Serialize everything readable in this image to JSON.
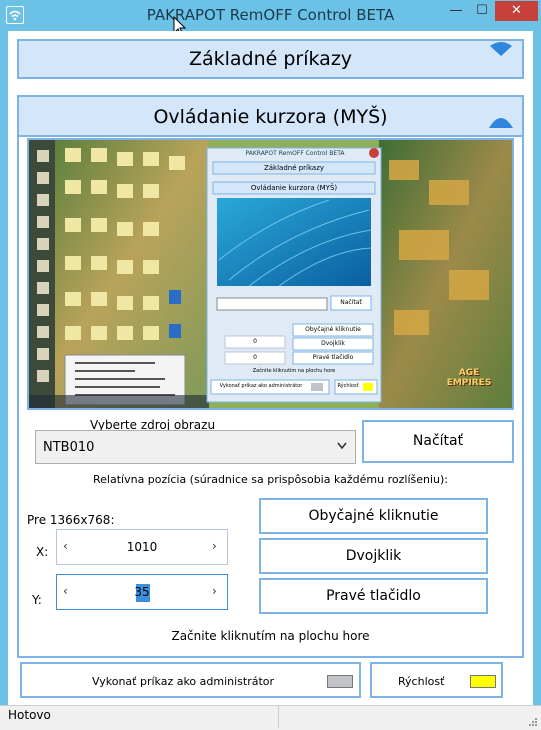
{
  "window": {
    "title": "PAKRAPOT RemOFF Control BETA",
    "minimize_glyph": "—",
    "maximize_glyph": "☐",
    "close_glyph": "✕"
  },
  "sections": {
    "basic_commands": "Základné príkazy",
    "cursor_control": "Ovládanie kurzora (MYŠ)"
  },
  "image_source": {
    "label": "Vyberte zdroj obrazu",
    "selected": "NTB010",
    "load_button": "Načítať"
  },
  "relative_position_note": "Relatívna pozícia (súradnice sa prispôsobia každému rozlíšeniu):",
  "resolution_label": "Pre 1366x768:",
  "coords": {
    "x_label": "X:",
    "x_value": "1010",
    "y_label": "Y:",
    "y_value": "35"
  },
  "click_buttons": {
    "single": "Obyčajné kliknutie",
    "double": "Dvojklik",
    "right": "Pravé tlačidlo"
  },
  "hint": "Začnite kliknutím na plochu hore",
  "footer": {
    "admin_label": "Vykonať príkaz ako administrátor",
    "admin_color": "#c0c4c8",
    "speed_label": "Rýchlosť",
    "speed_color": "#ffff00"
  },
  "status": "Hotovo",
  "preview": {
    "title": "PAKRAPOT RemOFF Control BETA",
    "basic": "Základné príkazy",
    "cursor": "Ovládanie kurzora (MYŠ)",
    "load": "Načítať",
    "btn_single": "Obyčajné kliknutie",
    "btn_double": "Dvojklik",
    "btn_right": "Pravé tlačidlo",
    "hint": "Začnite kliknutím na plochu hore",
    "admin": "Vykonať príkaz ako administrátor",
    "speed": "Rýchlosť",
    "x_value": "0",
    "y_value": "0",
    "logo_top": "AGE",
    "logo_bottom": "EMPIRES"
  }
}
